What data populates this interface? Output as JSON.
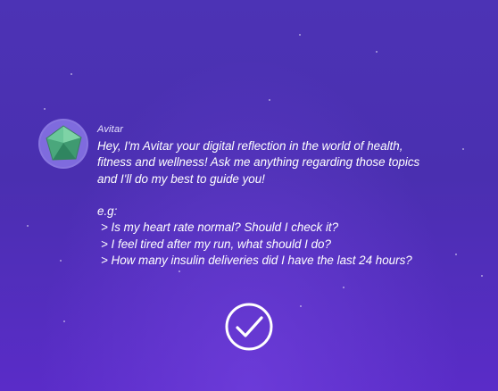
{
  "chat": {
    "sender": "Avitar",
    "message_lines": [
      "Hey, I'm Avitar your digital reflection in the world of health,",
      "fitness and wellness! Ask me anything regarding those topics",
      "and I'll do my best to guide you!"
    ],
    "examples_label": "e.g:",
    "examples": [
      "> Is my heart rate normal? Should I check it?",
      "> I feel tired after my run, what should I do?",
      "> How many insulin deliveries did I have the last 24 hours?"
    ]
  },
  "icons": {
    "avatar": "pentagon-gem-avatar-icon",
    "confirm": "check-circle-icon"
  },
  "colors": {
    "background_top": "#4c33b5",
    "background_bottom": "#5a2cc8",
    "avatar_bg": "#7f6bde",
    "avatar_gem": "#4fae80",
    "text": "#ffffff"
  }
}
